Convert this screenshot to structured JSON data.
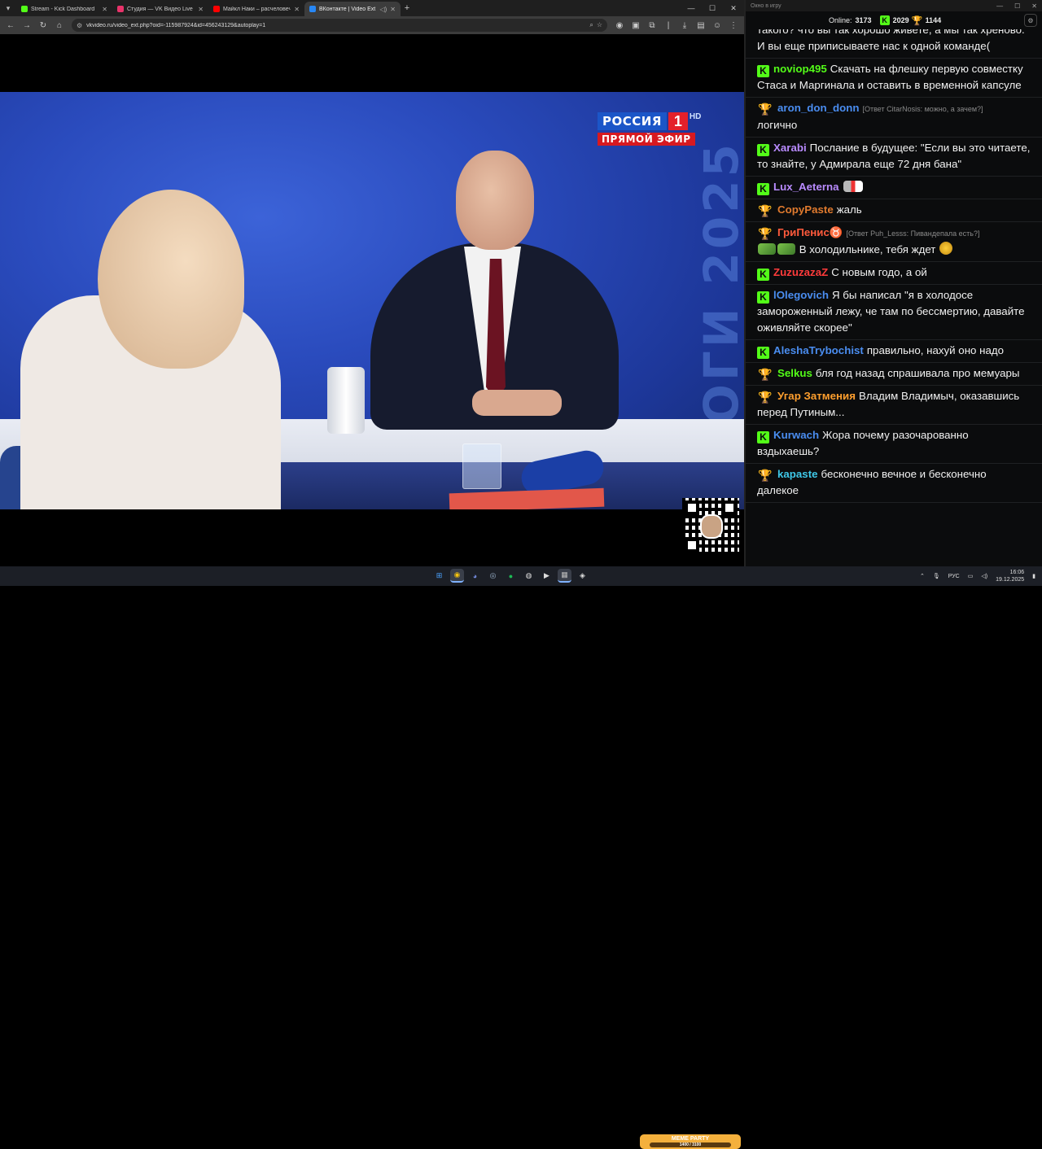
{
  "browser": {
    "tabs": [
      {
        "title": "Stream - Kick Dashboard",
        "color": "#53fc18",
        "active": false
      },
      {
        "title": "Студия — VK Видео Live",
        "color": "#e8336a",
        "active": false
      },
      {
        "title": "Майкл Наки – расчеловечива...",
        "color": "#ff0000",
        "active": false
      },
      {
        "title": "ВКонтакте | Video Ext",
        "color": "#2787f5",
        "active": true
      }
    ],
    "url": "vkvideo.ru/video_ext.php?oid=-115987924&id=456243129&autoplay=1"
  },
  "video": {
    "channel_name": "РОССИЯ",
    "channel_number": "1",
    "hd_label": "HD",
    "live_label": "ПРЯМОЙ ЭФИР",
    "background_text": "ИТОГИ 2025"
  },
  "chat": {
    "window_title": "Окно в игру",
    "online_label": "Online:",
    "online_count": "3173",
    "kick_count": "2029",
    "trophy_count": "1144",
    "messages": [
      {
        "badge": "k",
        "user": "Lux_Aeterna",
        "color": "#b98bff",
        "reply": "",
        "text": "Тов. Ну. а что ваши предки сделали такого? что вы так хорошо живете, а мы так хреново. И вы еще приписываете нас к одной команде("
      },
      {
        "badge": "k",
        "user": "noviop495",
        "color": "#53fc18",
        "reply": "",
        "text": "Скачать на флешку первую совместку Стаса и Маргинала и оставить в временной капсуле"
      },
      {
        "badge": "t",
        "user": "aron_don_donn",
        "color": "#4a8df0",
        "reply": "[Ответ CitarNosis: можно, а зачем?]",
        "text": "логично"
      },
      {
        "badge": "k",
        "user": "Xarabi",
        "color": "#b98bff",
        "reply": "",
        "text": "Послание в будущее: \"Если вы это читаете, то знайте, у Адмирала еще 72 дня бана\""
      },
      {
        "badge": "k",
        "user": "Lux_Aeterna",
        "color": "#b98bff",
        "reply": "",
        "text": ""
      },
      {
        "badge": "t",
        "user": "CopyPaste",
        "color": "#e07a2e",
        "reply": "",
        "text": "жаль"
      },
      {
        "badge": "t",
        "user": "ГриПенис♉",
        "color": "#ff5a3c",
        "reply": "[Ответ Puh_Lesss: Пивандепала есть?]",
        "text": "В холодильнике, тебя ждет"
      },
      {
        "badge": "k",
        "user": "ZuzuzazaZ",
        "color": "#ff3b3b",
        "reply": "",
        "text": "С новым годо, а ой"
      },
      {
        "badge": "k",
        "user": "lOlegovich",
        "color": "#4a8df0",
        "reply": "",
        "text": "Я бы написал \"я в холодосе замороженный лежу, че там по бессмертию, давайте оживляйте скорее\""
      },
      {
        "badge": "k",
        "user": "AleshaTrybochist",
        "color": "#4a8df0",
        "reply": "",
        "text": "правильно, нахуй оно надо"
      },
      {
        "badge": "t",
        "user": "Selkus",
        "color": "#53fc18",
        "reply": "",
        "text": "бля год назад спрашивала про мемуары"
      },
      {
        "badge": "t",
        "user": "Угар Затмения",
        "color": "#ff9f2e",
        "reply": "",
        "text": "Владим Владимыч, оказавшись перед Путиным..."
      },
      {
        "badge": "k",
        "user": "Kurwach",
        "color": "#4a8df0",
        "reply": "",
        "text": "Жора почему разочарованно вздыхаешь?"
      },
      {
        "badge": "t",
        "user": "kapaste",
        "color": "#3fc8e8",
        "reply": "",
        "text": "бесконечно вечное и бесконечно далекое"
      }
    ]
  },
  "taskbar": {
    "meme_title": "MEME PARTY",
    "meme_progress": "1400 / 3100",
    "lang": "РУС",
    "time": "16:06",
    "date": "19.12.2025"
  }
}
